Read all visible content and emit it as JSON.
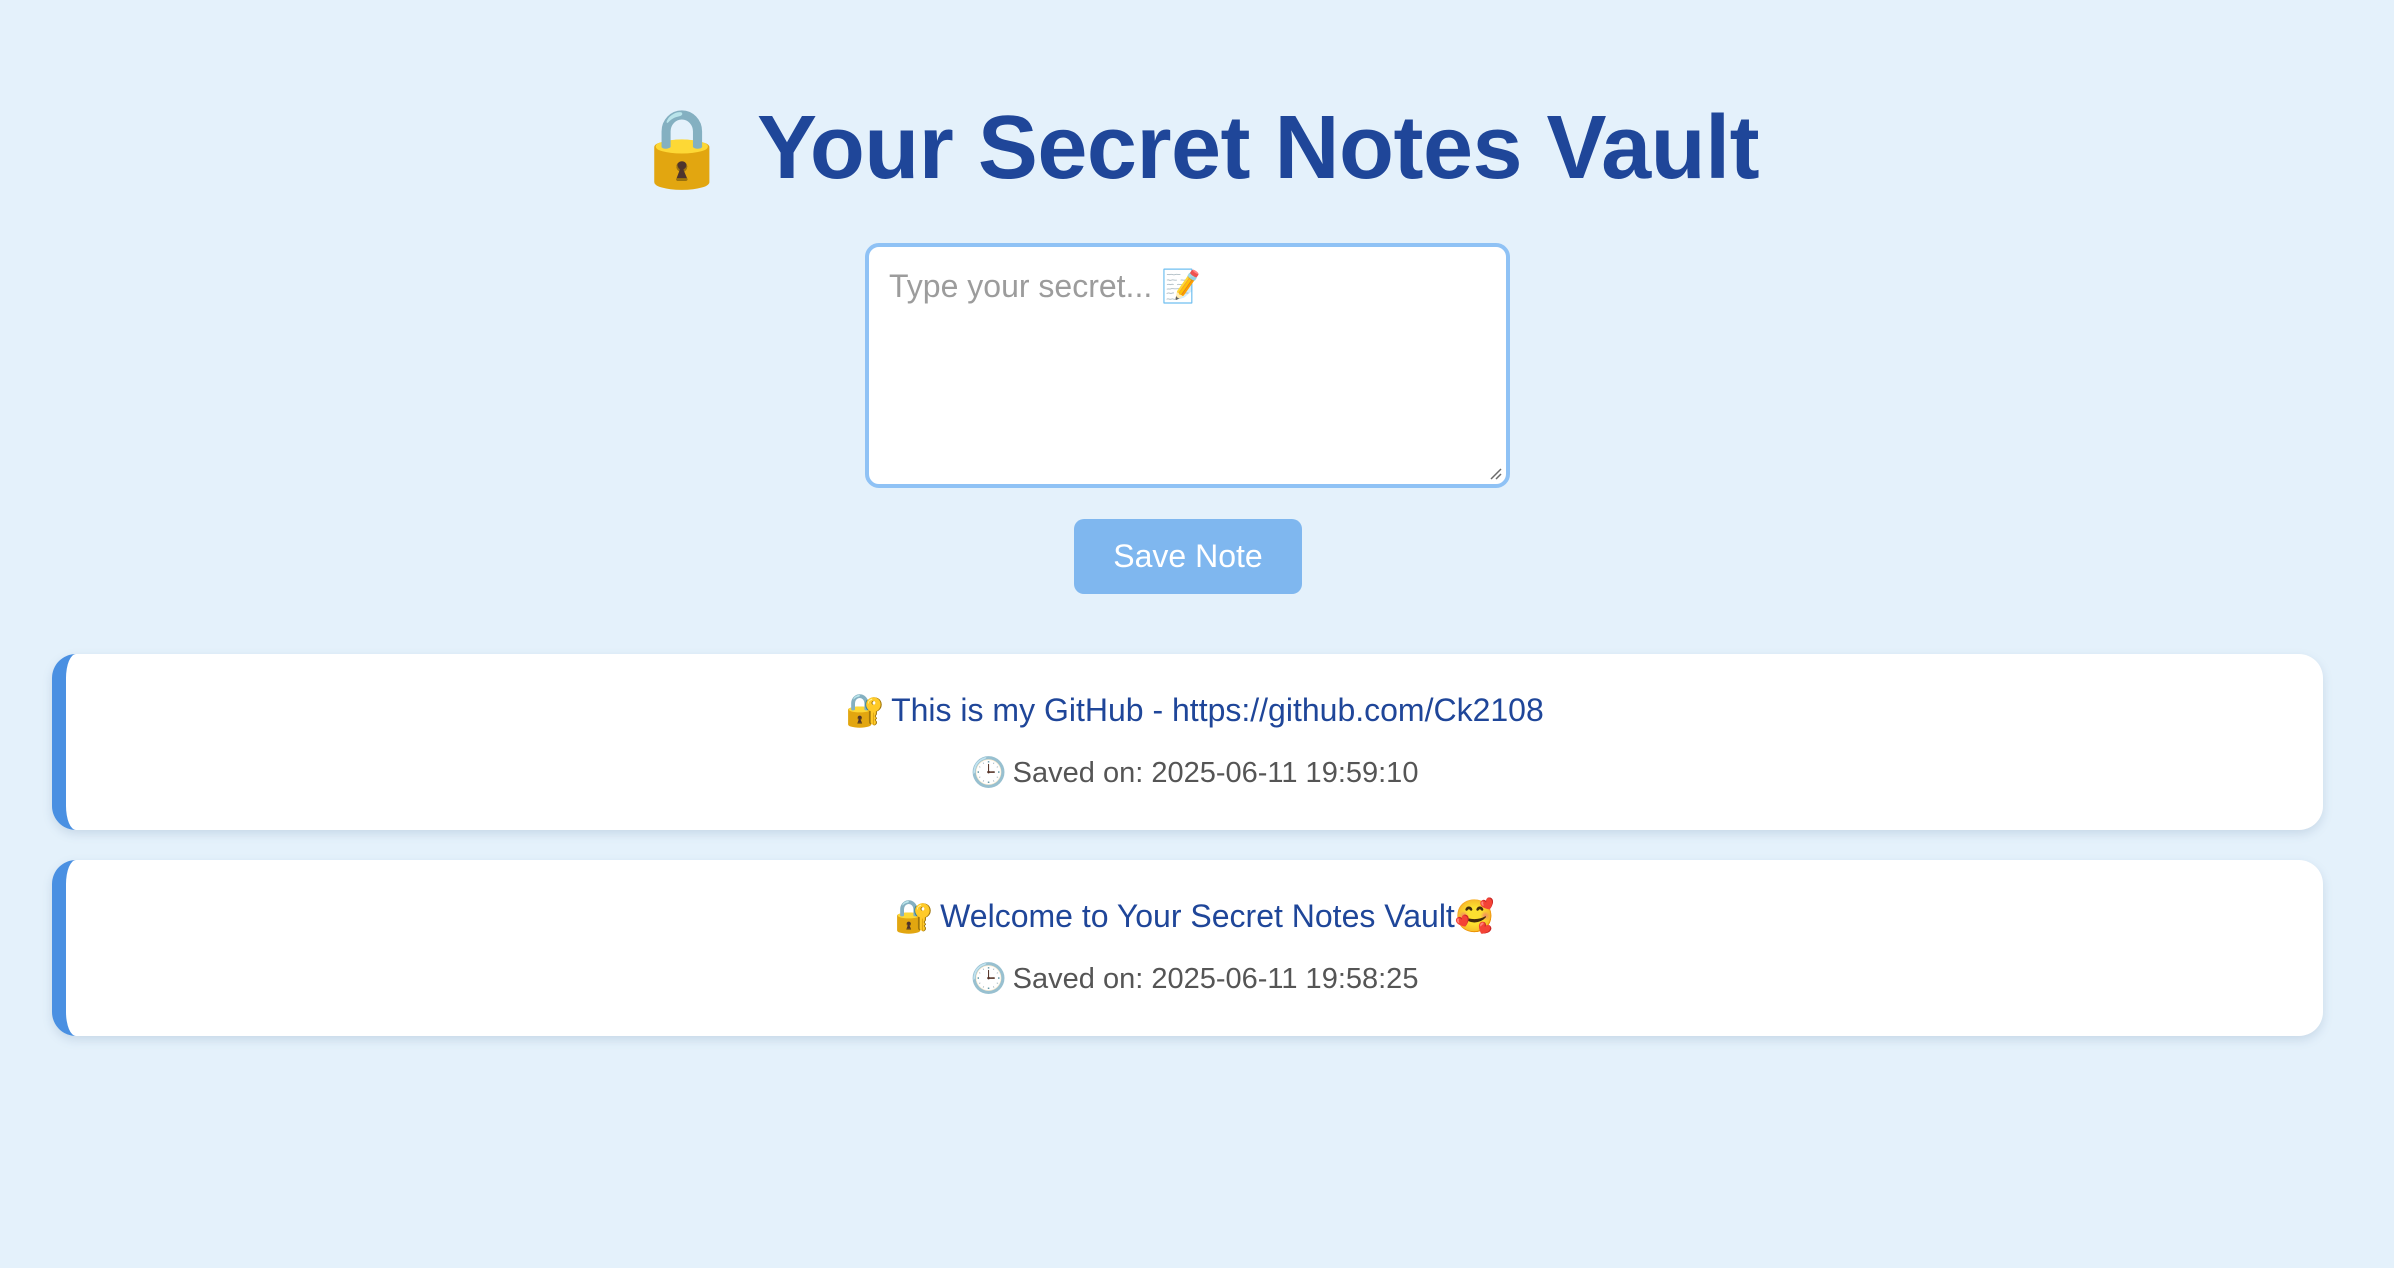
{
  "header": {
    "lock_icon": "🔒",
    "title": "Your Secret Notes Vault"
  },
  "editor": {
    "placeholder": "Type your secret... 📝",
    "value": ""
  },
  "toolbar": {
    "save_label": "Save Note"
  },
  "notes": [
    {
      "icon": "🔐",
      "text": "This is my GitHub - https://github.com/Ck2108",
      "time_icon": "🕒",
      "saved": "Saved on: 2025-06-11 19:59:10"
    },
    {
      "icon": "🔐",
      "text": "Welcome to Your Secret Notes Vault🥰",
      "time_icon": "🕒",
      "saved": "Saved on: 2025-06-11 19:58:25"
    }
  ],
  "colors": {
    "background": "#e4f1fb",
    "title": "#1f4699",
    "button": "#7fb7ef",
    "card_accent": "#4a90e2",
    "textarea_border": "#8fc2f5"
  }
}
